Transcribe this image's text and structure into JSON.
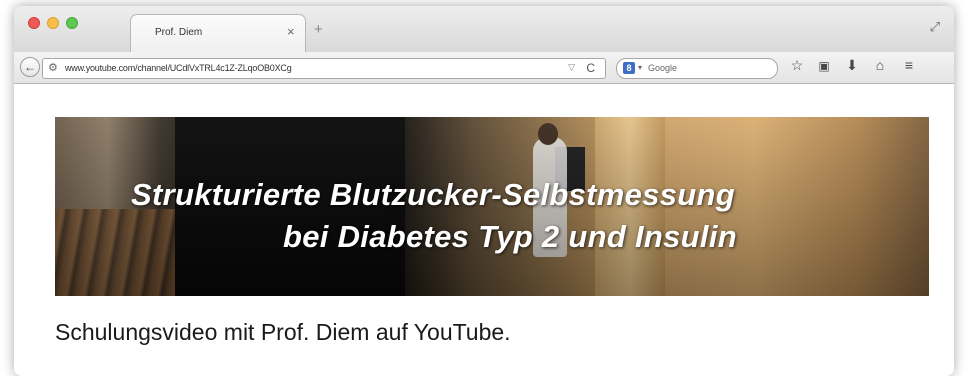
{
  "browser": {
    "tab": {
      "title": "Prof. Diem",
      "close": "×"
    },
    "new_tab": "+",
    "address_bar": {
      "url": "www.youtube.com/channel/UCdlVxTRL4c1Z-ZLqoOB0XCg"
    },
    "search_bar": {
      "placeholder": "Google"
    },
    "icons": [
      "back-icon",
      "site-identity-icon",
      "dropdown-icon",
      "reload-icon",
      "google-search-icon",
      "bookmark-star-icon",
      "reading-list-icon",
      "downloads-icon",
      "home-icon",
      "menu-icon",
      "resize-icon"
    ],
    "glyphs": {
      "back": "←",
      "site": "⚙",
      "dropdown": "▽",
      "reload": "C",
      "google": "8",
      "search_dd": "▾",
      "star": "☆",
      "book": "▣",
      "download": "⬇",
      "home": "⌂",
      "menu": "≡",
      "resize": "⤢"
    }
  },
  "page": {
    "banner": {
      "line1": "Strukturierte Blutzucker-Selbstmessung",
      "line2": "bei Diabetes Typ 2 und Insulin"
    },
    "caption": "Schulungsvideo mit Prof. Diem auf YouTube."
  },
  "colors": {
    "close": "#ee5a55",
    "minimize": "#f6c04a",
    "maximize": "#5fc853",
    "banner_text": "#ffffff",
    "caption_text": "#1a1a1a"
  }
}
